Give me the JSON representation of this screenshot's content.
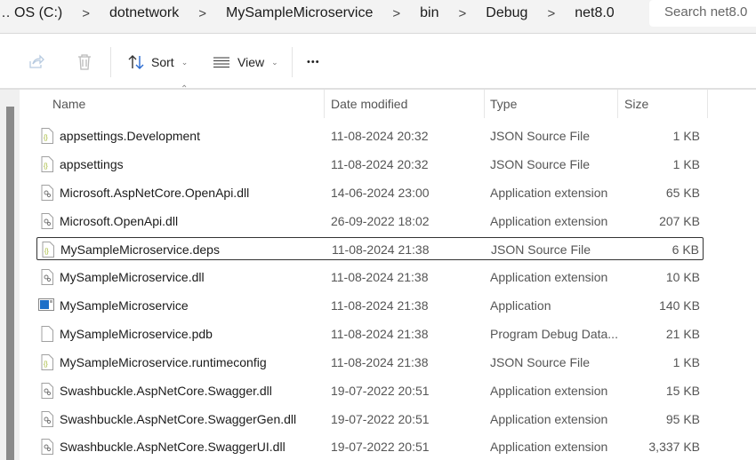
{
  "breadcrumb": {
    "overflow": "…",
    "items": [
      "OS (C:)",
      "dotnetwork",
      "MySampleMicroservice",
      "bin",
      "Debug",
      "net8.0"
    ],
    "separator": ">"
  },
  "search": {
    "placeholder": "Search net8.0"
  },
  "toolbar": {
    "sort": "Sort",
    "view": "View",
    "more": "•••"
  },
  "columns": {
    "name": "Name",
    "date": "Date modified",
    "type": "Type",
    "size": "Size"
  },
  "files": [
    {
      "name": "appsettings.Development",
      "date": "11-08-2024 20:32",
      "type": "JSON Source File",
      "size": "1 KB",
      "icon": "json"
    },
    {
      "name": "appsettings",
      "date": "11-08-2024 20:32",
      "type": "JSON Source File",
      "size": "1 KB",
      "icon": "json"
    },
    {
      "name": "Microsoft.AspNetCore.OpenApi.dll",
      "date": "14-06-2024 23:00",
      "type": "Application extension",
      "size": "65 KB",
      "icon": "dll"
    },
    {
      "name": "Microsoft.OpenApi.dll",
      "date": "26-09-2022 18:02",
      "type": "Application extension",
      "size": "207 KB",
      "icon": "dll"
    },
    {
      "name": "MySampleMicroservice.deps",
      "date": "11-08-2024 21:38",
      "type": "JSON Source File",
      "size": "6 KB",
      "icon": "json",
      "selected": true
    },
    {
      "name": "MySampleMicroservice.dll",
      "date": "11-08-2024 21:38",
      "type": "Application extension",
      "size": "10 KB",
      "icon": "dll"
    },
    {
      "name": "MySampleMicroservice",
      "date": "11-08-2024 21:38",
      "type": "Application",
      "size": "140 KB",
      "icon": "exe"
    },
    {
      "name": "MySampleMicroservice.pdb",
      "date": "11-08-2024 21:38",
      "type": "Program Debug Data...",
      "size": "21 KB",
      "icon": "file"
    },
    {
      "name": "MySampleMicroservice.runtimeconfig",
      "date": "11-08-2024 21:38",
      "type": "JSON Source File",
      "size": "1 KB",
      "icon": "json"
    },
    {
      "name": "Swashbuckle.AspNetCore.Swagger.dll",
      "date": "19-07-2022 20:51",
      "type": "Application extension",
      "size": "15 KB",
      "icon": "dll"
    },
    {
      "name": "Swashbuckle.AspNetCore.SwaggerGen.dll",
      "date": "19-07-2022 20:51",
      "type": "Application extension",
      "size": "95 KB",
      "icon": "dll"
    },
    {
      "name": "Swashbuckle.AspNetCore.SwaggerUI.dll",
      "date": "19-07-2022 20:51",
      "type": "Application extension",
      "size": "3,337 KB",
      "icon": "dll"
    }
  ]
}
